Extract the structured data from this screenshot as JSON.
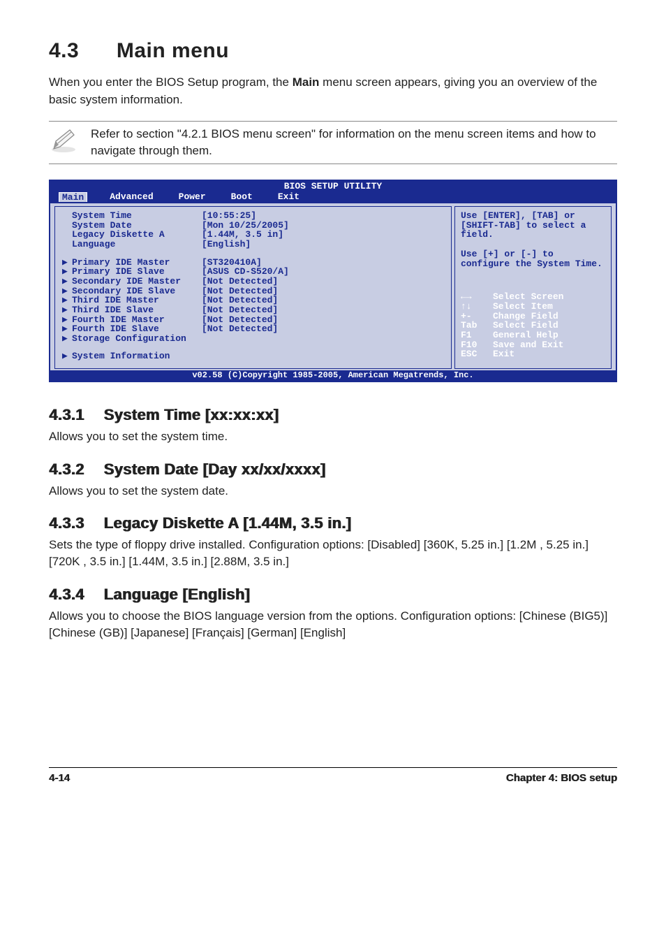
{
  "header": {
    "section_number": "4.3",
    "title": "Main menu"
  },
  "intro": "When you enter the BIOS Setup program, the Main menu screen appears, giving you an overview of the basic system information.",
  "intro_bold": "Main",
  "note": "Refer to section \"4.2.1  BIOS menu screen\" for information on the menu screen items and how to navigate through them.",
  "bios": {
    "title": "BIOS SETUP UTILITY",
    "tabs": [
      "Main",
      "Advanced",
      "Power",
      "Boot",
      "Exit"
    ],
    "active_tab": "Main",
    "top_rows": [
      {
        "label": "System Time",
        "value": "[10:55:25]",
        "arrow": false
      },
      {
        "label": "System Date",
        "value": "[Mon 10/25/2005]",
        "arrow": false
      },
      {
        "label": "Legacy Diskette A",
        "value": "[1.44M, 3.5 in]",
        "arrow": false
      },
      {
        "label": "Language",
        "value": "[English]",
        "arrow": false
      }
    ],
    "mid_rows": [
      {
        "label": "Primary IDE Master",
        "value": "[ST320410A]",
        "arrow": true
      },
      {
        "label": "Primary IDE Slave",
        "value": "[ASUS CD-S520/A]",
        "arrow": true
      },
      {
        "label": "Secondary IDE Master",
        "value": "[Not Detected]",
        "arrow": true
      },
      {
        "label": "Secondary IDE Slave",
        "value": "[Not Detected]",
        "arrow": true
      },
      {
        "label": "Third IDE Master",
        "value": "[Not Detected]",
        "arrow": true
      },
      {
        "label": "Third IDE Slave",
        "value": "[Not Detected]",
        "arrow": true
      },
      {
        "label": "Fourth IDE Master",
        "value": "[Not Detected]",
        "arrow": true
      },
      {
        "label": "Fourth IDE Slave",
        "value": "[Not Detected]",
        "arrow": true
      },
      {
        "label": "Storage Configuration",
        "value": "",
        "arrow": true
      }
    ],
    "bottom_rows": [
      {
        "label": "System Information",
        "value": "",
        "arrow": true
      }
    ],
    "help_top": "Use [ENTER], [TAB] or [SHIFT-TAB] to select a field.",
    "help_mid": "Use [+] or [-] to configure the System Time.",
    "keyhints": [
      {
        "k": "←→",
        "d": "Select Screen"
      },
      {
        "k": "↑↓",
        "d": "Select Item"
      },
      {
        "k": "+-",
        "d": "Change Field"
      },
      {
        "k": "Tab",
        "d": "Select Field"
      },
      {
        "k": "F1",
        "d": "General Help"
      },
      {
        "k": "F10",
        "d": "Save and Exit"
      },
      {
        "k": "ESC",
        "d": "Exit"
      }
    ],
    "footer": "v02.58 (C)Copyright 1985-2005, American Megatrends, Inc."
  },
  "sections": {
    "s1": {
      "num": "4.3.1",
      "title": "System Time [xx:xx:xx]",
      "body": "Allows you to set the system time."
    },
    "s2": {
      "num": "4.3.2",
      "title": "System Date [Day xx/xx/xxxx]",
      "body": "Allows you to set the system date."
    },
    "s3": {
      "num": "4.3.3",
      "title": "Legacy Diskette A [1.44M, 3.5 in.]",
      "body": "Sets the type of floppy drive installed. Configuration options: [Disabled] [360K, 5.25 in.] [1.2M , 5.25 in.] [720K , 3.5 in.] [1.44M, 3.5 in.] [2.88M, 3.5 in.]"
    },
    "s4": {
      "num": "4.3.4",
      "title": "Language [English]",
      "body": "Allows you to choose the BIOS language version from the options. Configuration options: [Chinese (BIG5)] [Chinese (GB)] [Japanese] [Français] [German] [English]"
    }
  },
  "footer": {
    "left": "4-14",
    "right": "Chapter 4: BIOS setup"
  }
}
